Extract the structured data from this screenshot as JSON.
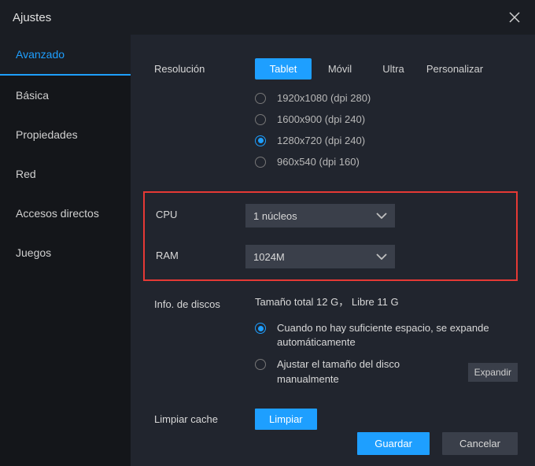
{
  "title": "Ajustes",
  "sidebar": {
    "items": [
      {
        "label": "Avanzado",
        "active": true
      },
      {
        "label": "Básica"
      },
      {
        "label": "Propiedades"
      },
      {
        "label": "Red"
      },
      {
        "label": "Accesos directos"
      },
      {
        "label": "Juegos"
      }
    ]
  },
  "resolution": {
    "label": "Resolución",
    "modes": {
      "tablet": "Tablet",
      "movil": "Móvil",
      "ultra": "Ultra",
      "personalizar": "Personalizar"
    },
    "options": [
      "1920x1080  (dpi 280)",
      "1600x900  (dpi 240)",
      "1280x720  (dpi 240)",
      "960x540  (dpi 160)"
    ],
    "selected_index": 2
  },
  "cpu": {
    "label": "CPU",
    "value": "1 núcleos"
  },
  "ram": {
    "label": "RAM",
    "value": "1024M"
  },
  "disk": {
    "label": "Info. de discos",
    "summary": "Tamaño total 12 G， Libre 11 G",
    "opt_auto": "Cuando no hay suficiente espacio, se expande automáticamente",
    "opt_manual": "Ajustar el tamaño del disco manualmente",
    "expand": "Expandir"
  },
  "cache": {
    "label": "Limpiar cache",
    "button": "Limpiar"
  },
  "footer": {
    "save": "Guardar",
    "cancel": "Cancelar"
  }
}
